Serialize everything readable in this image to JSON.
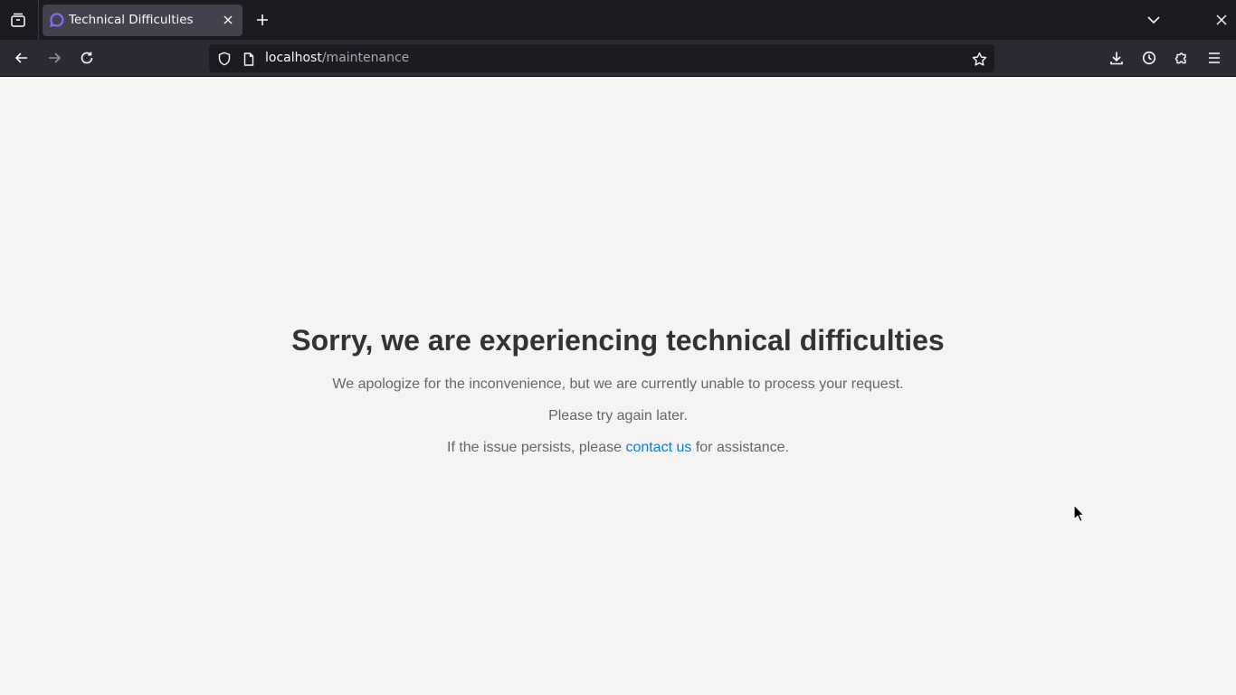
{
  "browser": {
    "tab": {
      "title": "Technical Difficulties",
      "favicon": "chat-bubble-icon"
    },
    "url": {
      "host": "localhost",
      "path": "/maintenance"
    },
    "icons": {
      "tab_manager": "tab-manager-icon",
      "new_tab": "plus-icon",
      "list_tabs": "chevron-down-icon",
      "close_window": "close-icon",
      "back": "arrow-left-icon",
      "forward": "arrow-right-icon",
      "reload": "reload-icon",
      "shield": "shield-icon",
      "page": "page-icon",
      "bookmark": "star-icon",
      "downloads": "download-icon",
      "history": "clock-icon",
      "extensions": "puzzle-icon",
      "menu": "hamburger-menu-icon"
    }
  },
  "page": {
    "heading": "Sorry, we are experiencing technical difficulties",
    "line1": "We apologize for the inconvenience, but we are currently unable to process your request.",
    "line2": "Please try again later.",
    "line3_before": "If the issue persists, please ",
    "line3_link": "contact us",
    "line3_after": " for assistance."
  },
  "colors": {
    "chrome_dark": "#1c1b22",
    "toolbar": "#2b2a33",
    "active_tab": "#42414d",
    "page_bg": "#f4f4f4",
    "heading": "#333333",
    "body_text": "#666666",
    "link": "#0a7bd9",
    "favicon": "#8a6cf0"
  }
}
